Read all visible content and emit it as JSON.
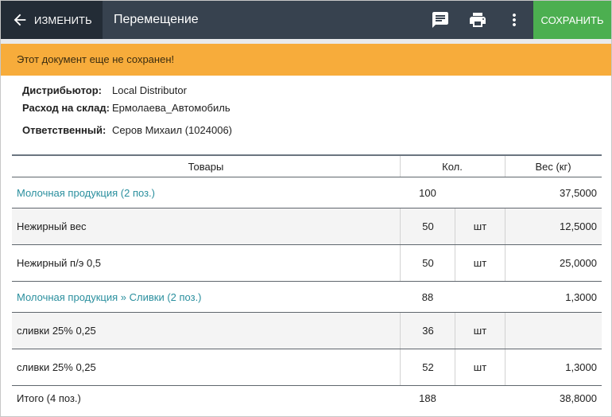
{
  "topbar": {
    "edit_label": "ИЗМЕНИТЬ",
    "title": "Перемещение",
    "save_label": "СОХРАНИТЬ",
    "icons": [
      "arrow-back-icon",
      "comment-icon",
      "print-icon",
      "more-vert-icon"
    ],
    "colors": {
      "bar": "#37424f",
      "edit_block": "#232c36",
      "save": "#4caf50"
    }
  },
  "warning": {
    "text": "Этот документ еще не сохранен!",
    "color": "#f7ac3b"
  },
  "info": {
    "distributor_label": "Дистрибьютор:",
    "distributor_value": "Local Distributor",
    "warehouse_label": "Расход на склад:",
    "warehouse_value": "Ермолаева_Автомобиль",
    "responsible_label": "Ответственный:",
    "responsible_value": "Серов Михаил (1024006)"
  },
  "table": {
    "headers": {
      "goods": "Товары",
      "qty": "Кол.",
      "weight": "Вес (кг)"
    },
    "groups": [
      {
        "name": "Молочная продукция (2 поз.)",
        "qty": "100",
        "weight": "37,5000",
        "items": [
          {
            "name": "Нежирный вес",
            "qty": "50",
            "unit": "шт",
            "weight": "12,5000"
          },
          {
            "name": "Нежирный п/э 0,5",
            "qty": "50",
            "unit": "шт",
            "weight": "25,0000"
          }
        ]
      },
      {
        "name": "Молочная продукция » Сливки (2 поз.)",
        "qty": "88",
        "weight": "1,3000",
        "items": [
          {
            "name": "сливки 25% 0,25",
            "qty": "36",
            "unit": "шт",
            "weight": ""
          },
          {
            "name": "сливки 25% 0,25",
            "qty": "52",
            "unit": "шт",
            "weight": "1,3000"
          }
        ]
      }
    ],
    "total": {
      "label": "Итого (4 поз.)",
      "qty": "188",
      "weight": "38,8000"
    }
  }
}
